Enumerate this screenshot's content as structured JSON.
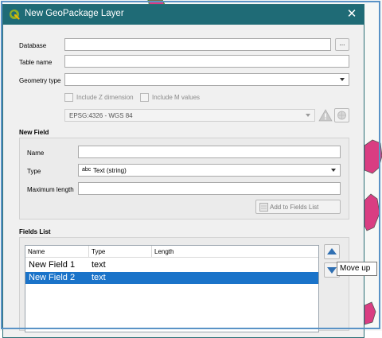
{
  "window": {
    "title": "New GeoPackage Layer",
    "close_glyph": "✕"
  },
  "form": {
    "database_label": "Database",
    "database_value": "",
    "browse_label": "...",
    "table_name_label": "Table name",
    "table_name_value": "",
    "geometry_type_label": "Geometry type",
    "geometry_type_value": "",
    "include_z_label": "Include Z dimension",
    "include_m_label": "Include M values",
    "crs_value": "EPSG:4326 - WGS 84"
  },
  "new_field": {
    "section_label": "New Field",
    "name_label": "Name",
    "name_value": "",
    "type_label": "Type",
    "type_icon_text": "abc",
    "type_value": "Text (string)",
    "max_length_label": "Maximum length",
    "max_length_value": "",
    "add_button_label": "Add to Fields List"
  },
  "fields_list": {
    "section_label": "Fields List",
    "columns": [
      "Name",
      "Type",
      "Length"
    ],
    "rows": [
      {
        "name": "New Field 1",
        "type": "text",
        "length": "",
        "selected": false
      },
      {
        "name": "New Field 2",
        "type": "text",
        "length": "",
        "selected": true
      }
    ]
  },
  "tooltip": {
    "text": "Move up"
  },
  "colors": {
    "titlebar": "#1f6b76",
    "selection": "#1a73c9",
    "map_polygon": "#d93d82",
    "map_outline": "#4a8f2e",
    "outer_frame": "#5a93c6"
  },
  "icons": {
    "app": "qgis-logo-icon",
    "crs_warning": "warning-triangle-icon",
    "crs_select": "globe-icon",
    "add_field": "add-field-icon",
    "move_up": "move-up-arrow-icon",
    "move_down": "move-down-arrow-icon"
  }
}
